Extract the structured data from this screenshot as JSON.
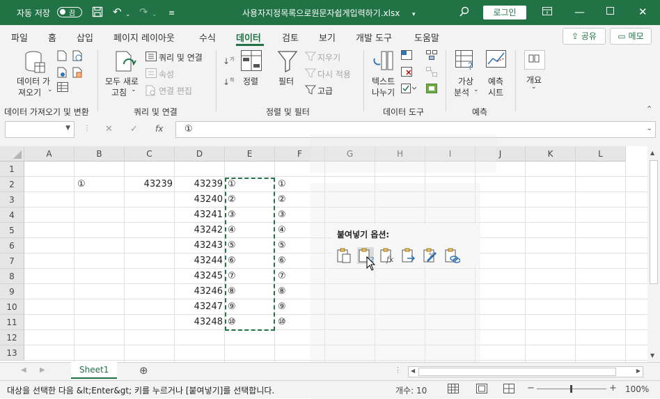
{
  "titlebar": {
    "autosave_label": "자동 저장",
    "autosave_state": "끔",
    "filename": "사용자지정목록으로원문자쉽게입력하기.xlsx",
    "login_label": "로그인"
  },
  "tabs": [
    "파일",
    "홈",
    "삽입",
    "페이지 레이아웃",
    "수식",
    "데이터",
    "검토",
    "보기",
    "개발 도구",
    "도움말"
  ],
  "active_tab": "데이터",
  "share_label": "공유",
  "memo_label": "메모",
  "ribbon": {
    "get_data": "데이터 가",
    "get_data2": "져오기",
    "refresh_all": "모두 새로",
    "refresh_all2": "고침",
    "queries_connections": "쿼리 및 연결",
    "properties": "속성",
    "edit_links": "연결 편집",
    "sort": "정렬",
    "filter": "필터",
    "clear": "지우기",
    "reapply": "다시 적용",
    "advanced": "고급",
    "text_to_columns": "텍스트",
    "text_to_columns2": "나누기",
    "what_if": "가상",
    "what_if2": "분석",
    "forecast_sheet": "예측",
    "forecast_sheet2": "시트",
    "outline": "개요",
    "groups": {
      "get_transform": "데이터 가져오기 및 변환",
      "queries": "쿼리 및 연결",
      "sort_filter": "정렬 및 필터",
      "data_tools": "데이터 도구",
      "forecast": "예측"
    }
  },
  "formula_bar": {
    "name_box": "",
    "content": "①"
  },
  "columns": [
    "A",
    "B",
    "C",
    "D",
    "E",
    "F",
    "G",
    "H",
    "I",
    "J",
    "K",
    "L"
  ],
  "rows": [
    "1",
    "2",
    "3",
    "4",
    "5",
    "6",
    "7",
    "8",
    "9",
    "10",
    "11",
    "12",
    "13"
  ],
  "cells": {
    "B2": "①",
    "C2": "43239",
    "D": [
      "43239",
      "43240",
      "43241",
      "43242",
      "43243",
      "43244",
      "43245",
      "43246",
      "43247",
      "43248"
    ],
    "E": [
      "①",
      "②",
      "③",
      "④",
      "⑤",
      "⑥",
      "⑦",
      "⑧",
      "⑨",
      "⑩"
    ],
    "F": [
      "①",
      "②",
      "③",
      "④",
      "⑤",
      "⑥",
      "⑦",
      "⑧",
      "⑨",
      "⑩"
    ]
  },
  "paste_options": {
    "title": "붙여넣기 옵션:",
    "icons": [
      "paste-icon",
      "paste-values-icon",
      "paste-formulas-icon",
      "paste-transpose-icon",
      "paste-formatting-icon",
      "paste-link-icon"
    ]
  },
  "sheet_tab": "Sheet1",
  "status": {
    "message": "대상을 선택한 다음 &lt;Enter&gt; 키를 누르거나 [붙여넣기]를 선택합니다.",
    "count": "개수: 10",
    "zoom": "100%"
  },
  "colors": {
    "brand": "#217346",
    "ribbon_bg": "#f3f3f3"
  }
}
